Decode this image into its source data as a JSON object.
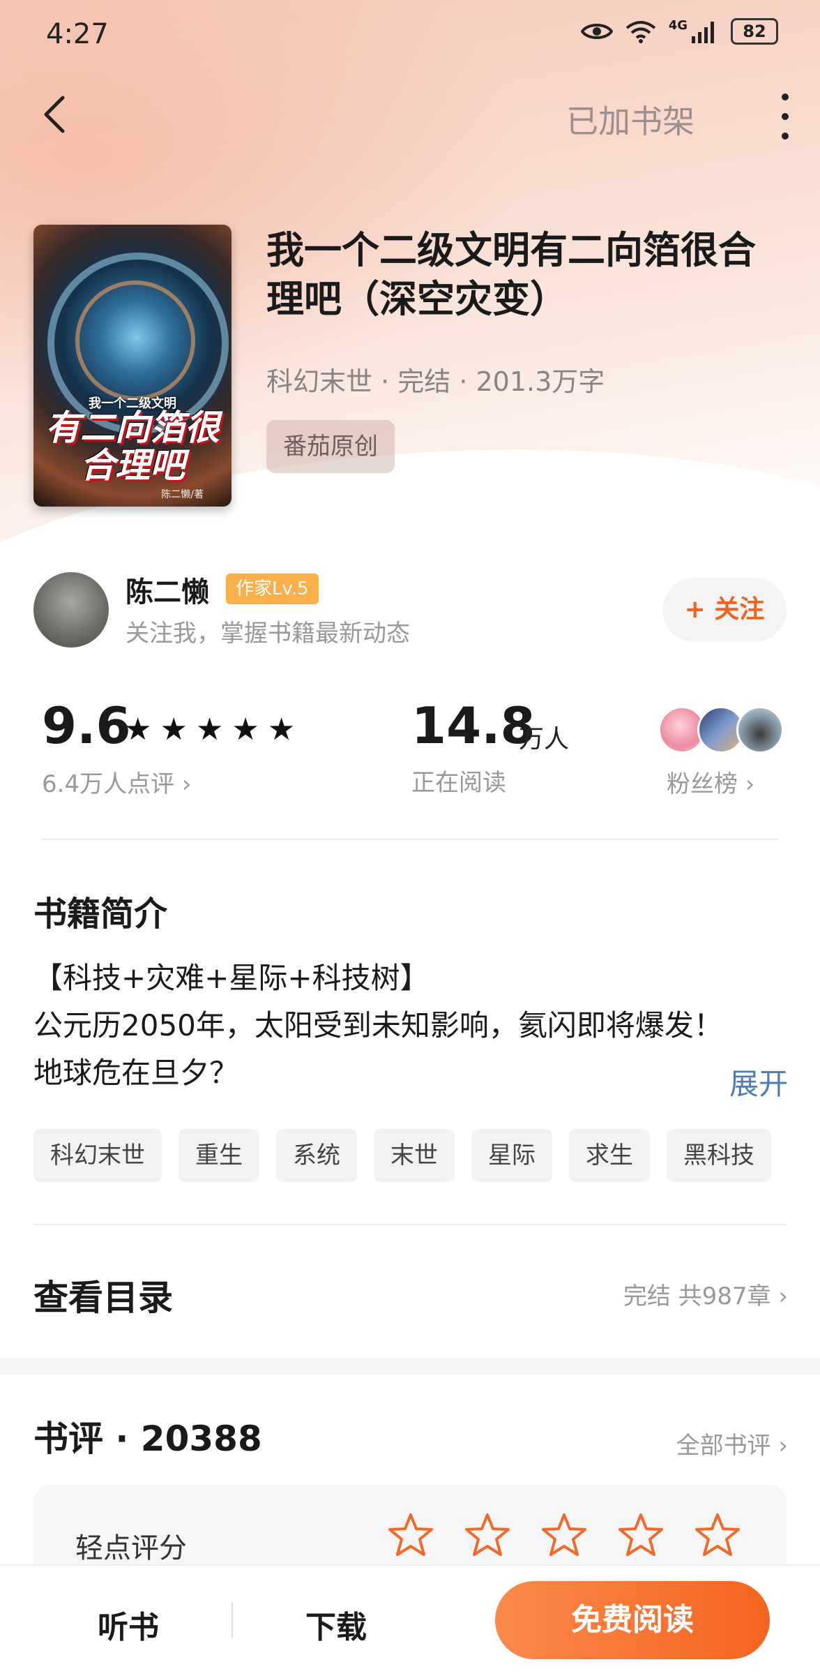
{
  "status_bar": {
    "time": "4:27",
    "battery": "82",
    "network": "4G"
  },
  "header": {
    "shelf_label": "已加书架"
  },
  "book": {
    "cover_small_text": "我一个二级文明",
    "cover_big_text": "有二向箔很合理吧",
    "cover_author_text": "陈二懒/著",
    "title": "我一个二级文明有二向箔很合理吧（深空灾变）",
    "meta": "科幻末世 · 完结 · 201.3万字",
    "tag": "番茄原创"
  },
  "author": {
    "name": "陈二懒",
    "level": "作家Lv.5",
    "subtitle": "关注我，掌握书籍最新动态",
    "follow_label": "+ 关注"
  },
  "stats": {
    "score": "9.6",
    "score_stars": 5,
    "score_count": "6.4万人点评 ›",
    "readers": "14.8",
    "readers_unit": "万人",
    "readers_label": "正在阅读",
    "fans_label": "粉丝榜 ›"
  },
  "intro": {
    "title": "书籍简介",
    "lines": [
      "【科技+灾难+星际+科技树】",
      "公元历2050年，太阳受到未知影响，氦闪即将爆发！",
      "地球危在旦夕？"
    ],
    "expand_label": "展开",
    "tags": [
      "科幻末世",
      "重生",
      "系统",
      "末世",
      "星际",
      "求生",
      "黑科技"
    ]
  },
  "toc": {
    "title": "查看目录",
    "info": "完结 共987章 ›"
  },
  "reviews": {
    "title": "书评 · 20388",
    "all_label": "全部书评 ›",
    "rate_label": "轻点评分"
  },
  "bottom": {
    "listen_label": "听书",
    "download_label": "下载",
    "read_label": "免费阅读"
  },
  "colors": {
    "accent": "#f5641f",
    "link": "#4e7cb3",
    "badge": "#f9b04a"
  }
}
